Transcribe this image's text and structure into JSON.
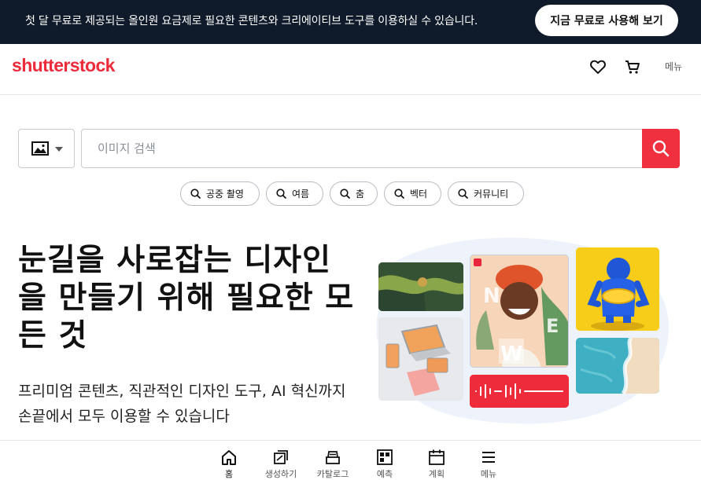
{
  "promo": {
    "text": "첫 달 무료로 제공되는 올인원 요금제로 필요한 콘텐츠와 크리에이티브 도구를 이용하실 수 있습니다.",
    "button": "지금 무료로 사용해 보기"
  },
  "header": {
    "logo": "shutterstock",
    "menu_label": "메뉴",
    "icons": [
      "heart-icon",
      "cart-icon"
    ]
  },
  "search": {
    "type_icon": "image-icon",
    "placeholder": "이미지 검색",
    "value": ""
  },
  "chips": [
    "공중 촬영",
    "여름",
    "춤",
    "벡터",
    "커뮤니티"
  ],
  "hero": {
    "headline": "눈길을 사로잡는 디자인을 만들기 위해 필요한 모든 것",
    "subtext": "프리미엄 콘텐츠, 직관적인 디자인 도구, AI 혁신까지 손끝에서 모두 이용할 수 있습니다",
    "collage_letters": [
      "N",
      "E",
      "W"
    ]
  },
  "bottom_nav": [
    {
      "label": "홈",
      "icon": "home-icon"
    },
    {
      "label": "생성하기",
      "icon": "create-icon"
    },
    {
      "label": "카탈로그",
      "icon": "catalog-icon"
    },
    {
      "label": "예측",
      "icon": "predict-icon"
    },
    {
      "label": "계획",
      "icon": "calendar-icon"
    },
    {
      "label": "메뉴",
      "icon": "menu-icon"
    }
  ],
  "colors": {
    "brand_red": "#ee2b3b",
    "promo_bg": "#0f1a2b"
  }
}
